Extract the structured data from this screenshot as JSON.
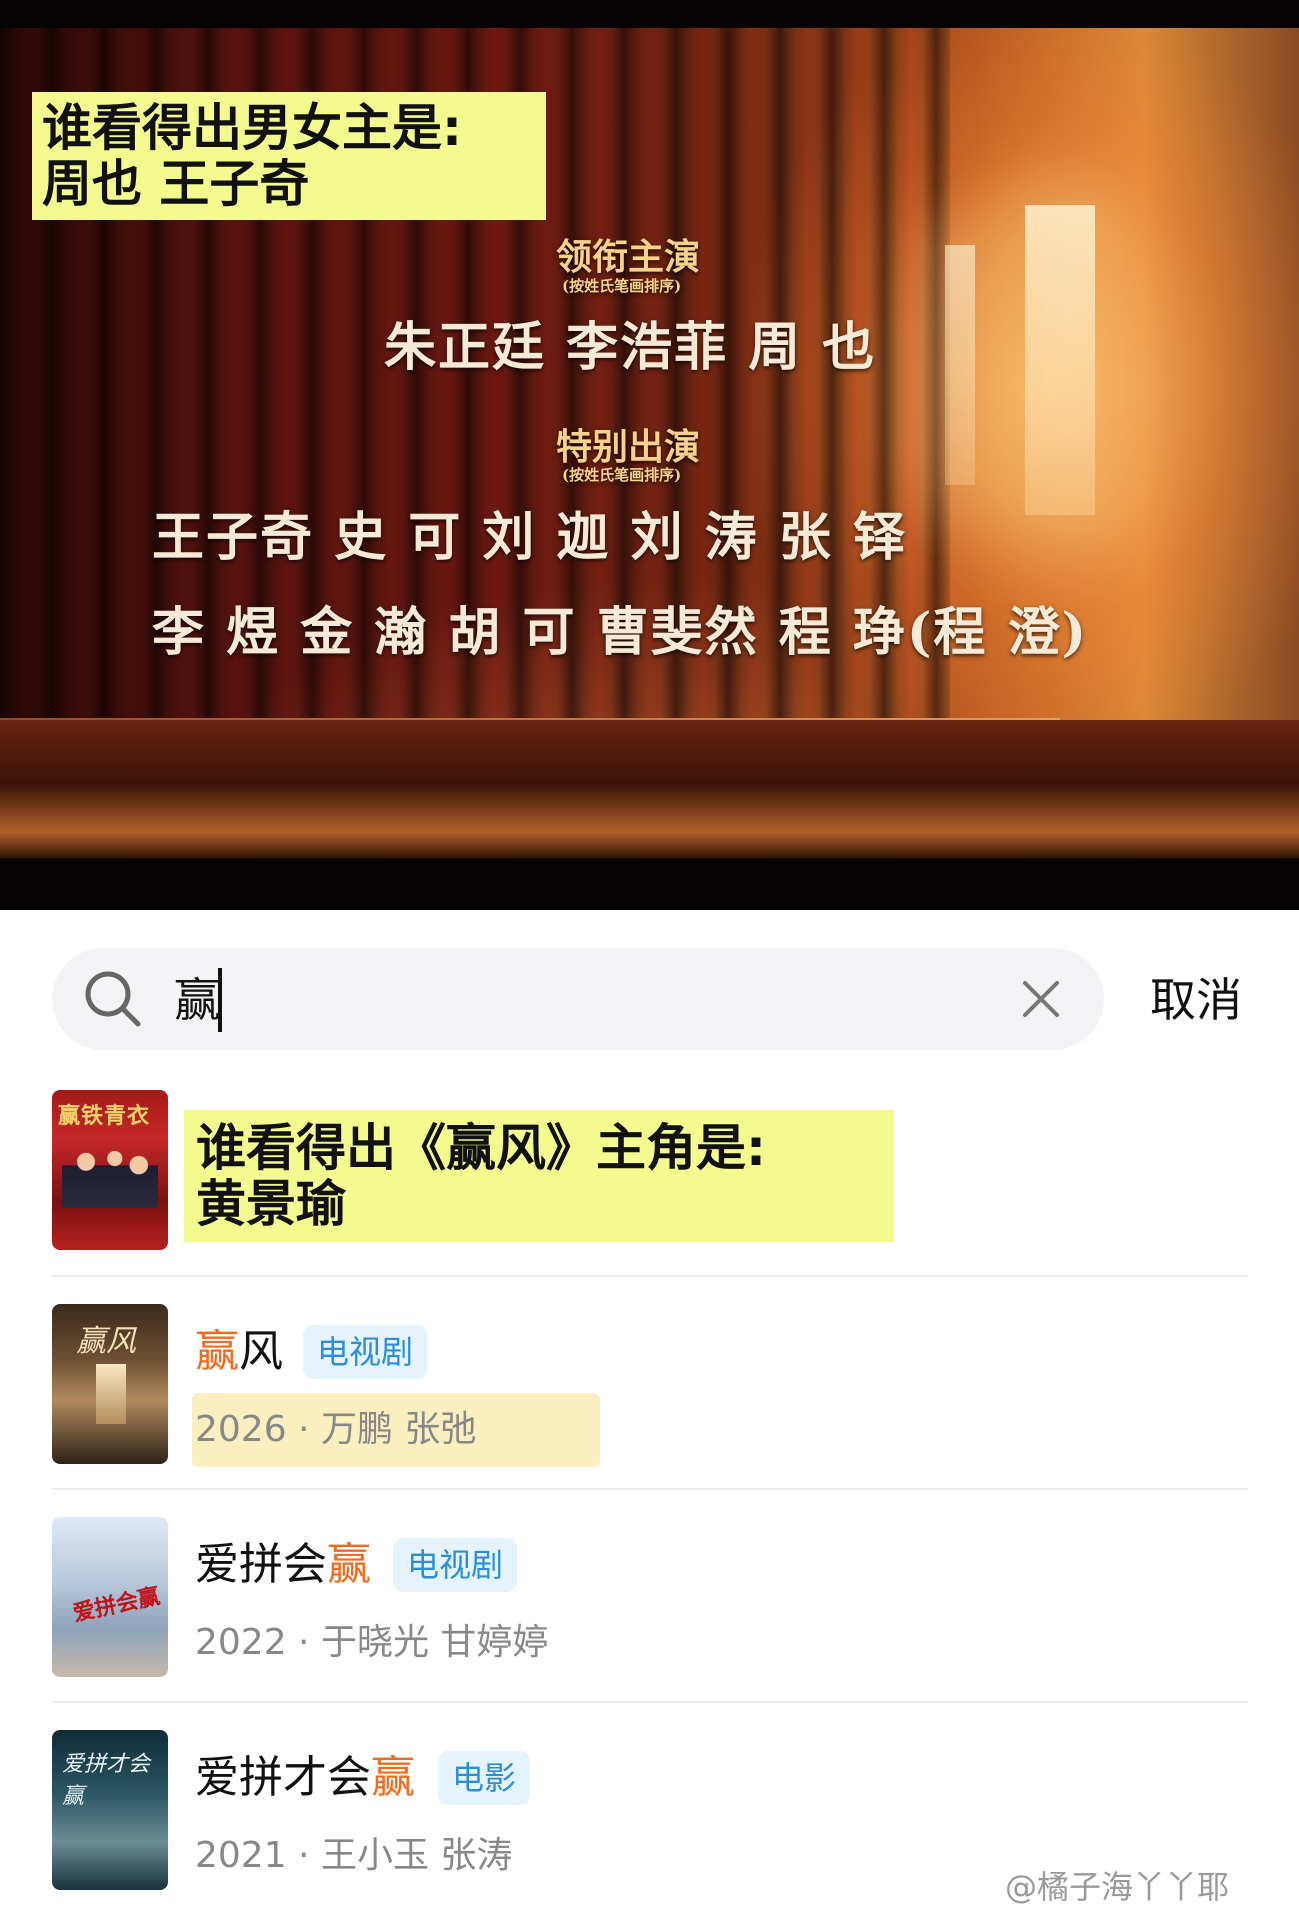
{
  "video": {
    "caption": [
      "谁看得出男女主是:",
      "周也 王子奇"
    ],
    "credits": {
      "heading_lead": "领衔主演",
      "note_lead": "(按姓氏笔画排序)",
      "lead_row": "朱正廷   李浩菲   周  也",
      "heading_special": "特别出演",
      "note_special": "(按姓氏笔画排序)",
      "special_row_1": "王子奇   史  可    刘  迦    刘  涛    张  铎",
      "special_row_2": "李  煜    金  瀚    胡  可    曹斐然     程  琤(程  澄)"
    }
  },
  "search": {
    "query": "赢",
    "cancel_label": "取消",
    "icons": [
      "search-icon",
      "clear-icon"
    ]
  },
  "featured": {
    "poster_text": "赢铁青衣",
    "caption": [
      "谁看得出《赢风》主角是:",
      "黄景瑜"
    ]
  },
  "results": [
    {
      "title_prefix": "",
      "title_accent": "赢",
      "title_suffix": "风",
      "tag": "电视剧",
      "meta": "2026 · 万鹏 张弛",
      "poster_text": "赢风"
    },
    {
      "title_prefix": "爱拼会",
      "title_accent": "赢",
      "title_suffix": "",
      "tag": "电视剧",
      "meta": "2022 · 于晓光 甘婷婷",
      "poster_text": "爱拼会赢"
    },
    {
      "title_prefix": "爱拼才会",
      "title_accent": "赢",
      "title_suffix": "",
      "tag": "电影",
      "meta": "2021 · 王小玉 张涛",
      "poster_text": "爱拼才会赢"
    }
  ],
  "watermark": "@橘子海丫丫耶",
  "colors": {
    "accent": "#f26b1d",
    "tag_text": "#2a8fd8",
    "tag_bg": "#e5f4fc",
    "highlight": "#f3fb8e"
  }
}
